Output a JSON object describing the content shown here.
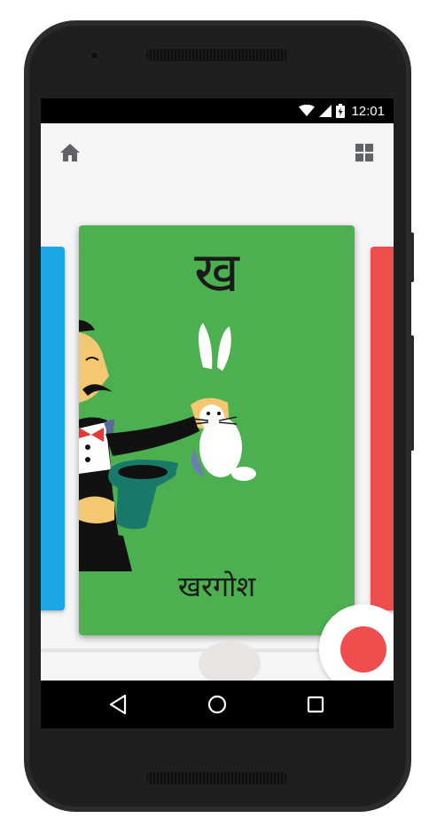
{
  "status_bar": {
    "time": "12:01",
    "icons": [
      "wifi-icon",
      "signal-icon",
      "battery-charging-icon"
    ]
  },
  "app_bar": {
    "icons": [
      "home-icon",
      "grid-view-icon"
    ]
  },
  "flashcard": {
    "letter": "ख",
    "word": "खरगोश",
    "illustration": "magician-pulling-rabbit-from-hat",
    "background_color": "#4caf50"
  },
  "adjacent_cards": {
    "previous_color": "#1ba6e8",
    "next_color": "#ef4e4e"
  },
  "controls": {
    "record_button_color": "#ef4e4e"
  },
  "nav_bar": {
    "icons": [
      "back-icon",
      "home-circle-icon",
      "recents-icon"
    ]
  }
}
